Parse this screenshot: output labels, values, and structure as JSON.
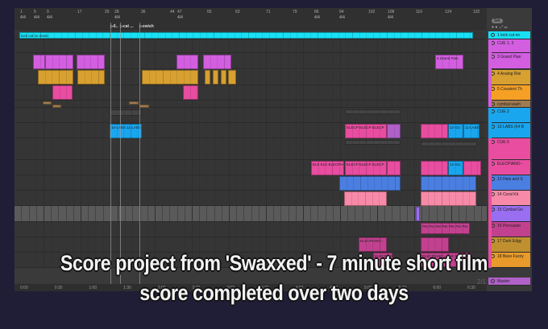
{
  "ruler": {
    "bars": [
      "1",
      "5",
      "9",
      "17",
      "25",
      "28",
      "36",
      "44",
      "47",
      "55",
      "63",
      "71",
      "79",
      "86",
      "94",
      "102",
      "108",
      "116",
      "124",
      "132"
    ],
    "time_signature": "4/4"
  },
  "locators": [
    "6..",
    "cat ...",
    "swish"
  ],
  "set_button": "Set",
  "timeline": [
    "0:00",
    "0:30",
    "1:00",
    "1:30",
    "2:00",
    "2:30",
    "3:00",
    "3:30",
    "4:00",
    "4:30",
    "5:00",
    "5:30",
    "6:00",
    "6:30"
  ],
  "zoom_readout": "2/1",
  "tracks": [
    {
      "name": "1 lock cut no",
      "color": "#19e0f5"
    },
    {
      "name": "CUE 1, 3",
      "color": "#d35ee0"
    },
    {
      "name": "3 Grand Pian",
      "color": "#d35ee0"
    },
    {
      "name": "4 Analog Risi",
      "color": "#d8a030"
    },
    {
      "name": "5 Covalent Th",
      "color": "#f5a024"
    },
    {
      "name": "cymbal wash",
      "color": "#a07a50"
    },
    {
      "name": "CUE 2",
      "color": "#1aa6ee"
    },
    {
      "name": "10 LABS (64 B",
      "color": "#1aa6ee"
    },
    {
      "name": "CUE 5",
      "color": "#e84da0"
    },
    {
      "name": "ELECPIANO -",
      "color": "#e84da0"
    },
    {
      "name": "13 Hats and S",
      "color": "#4a7ee0"
    },
    {
      "name": "14 Coral Kit",
      "color": "#f78aa8"
    },
    {
      "name": "15 Cymbal Gn",
      "color": "#9a6ef0"
    },
    {
      "name": "16 Percussio",
      "color": "#c2418f"
    },
    {
      "name": "17 Dark Edgy",
      "color": "#c09030"
    },
    {
      "name": "18 Bass Fuzzy",
      "color": "#e89a2a"
    },
    {
      "name": "Master",
      "color": "#b060c8"
    }
  ],
  "clips": {
    "lock": "lock cut no music",
    "grand": "4 Grand Pian",
    "labs": "10-LABS 11-LABS",
    "elecp3": "ELECP ELECP ELECP",
    "gu": "12-GU",
    "labs11": "11-LABS",
    "elecpia": "ELE ELE ELECPIA",
    "perc": "Per Per Per Per Per Per Per",
    "elec17": "ELECPIANO -",
    "elec18": "ELECPIAN",
    "elec18b": "ELECPIANO - CUE 5.4"
  },
  "caption": {
    "line1": "Score project from 'Swaxxed' - 7 minute short film",
    "line2": "score completed over two days"
  }
}
